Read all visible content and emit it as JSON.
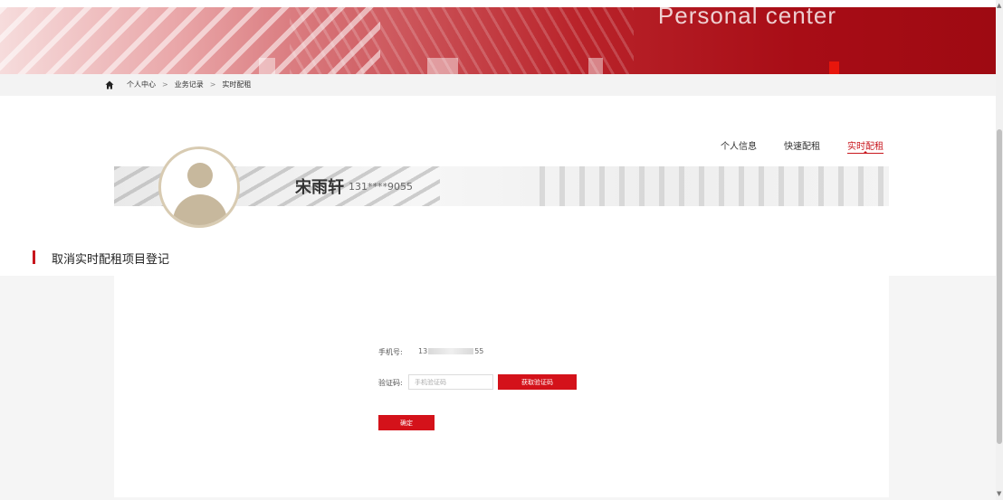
{
  "banner": {
    "title": "Personal center",
    "accent_color": "#a80d16"
  },
  "breadcrumb": {
    "home_icon": "home-icon",
    "items": [
      "个人中心",
      "业务记录",
      "实时配租"
    ],
    "separator": ">"
  },
  "profile": {
    "avatar_icon": "user-avatar-icon",
    "name": "宋雨轩",
    "phone": "131****9055",
    "tabs": [
      {
        "label": "个人信息",
        "active": false
      },
      {
        "label": "快速配租",
        "active": false
      },
      {
        "label": "实时配租",
        "active": true
      }
    ]
  },
  "section": {
    "title": "取消实时配租项目登记"
  },
  "form": {
    "phone_label": "手机号:",
    "phone_prefix": "13",
    "phone_suffix": "55",
    "code_label": "验证码:",
    "code_placeholder": "手机验证码",
    "get_code_button": "获取验证码",
    "confirm_button": "确定"
  },
  "colors": {
    "primary_red": "#d4121a",
    "active_tab": "#c8161d"
  }
}
